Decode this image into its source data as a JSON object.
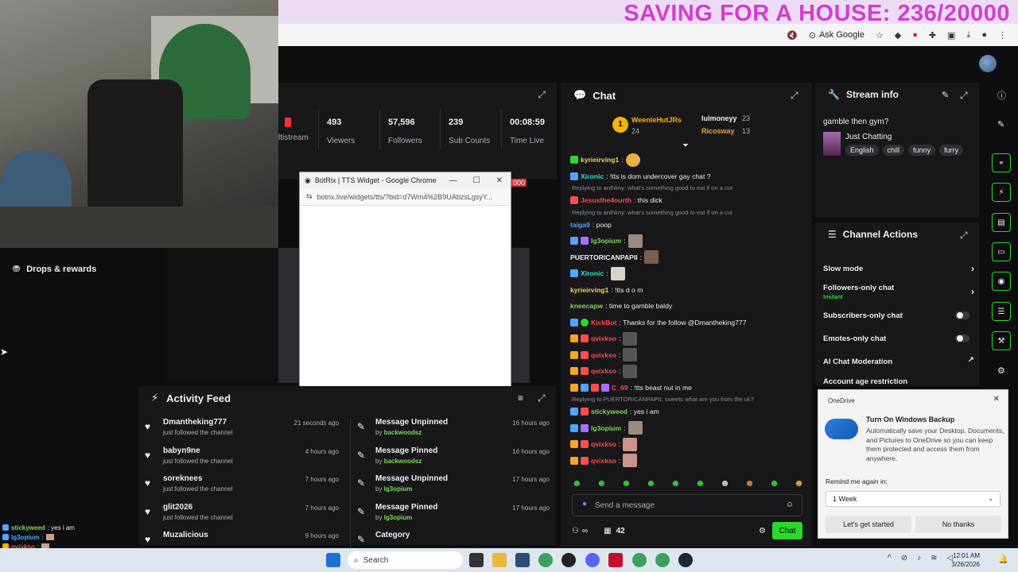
{
  "banner": {
    "text": "SAVING FOR A HOUSE: 236/20000"
  },
  "browser_toolbar": {
    "ask_google": "Ask Google"
  },
  "stats": [
    {
      "value": "",
      "label": "ltistream"
    },
    {
      "value": "493",
      "label": "Viewers"
    },
    {
      "value": "57,596",
      "label": "Followers"
    },
    {
      "value": "239",
      "label": "Sub Counts"
    },
    {
      "value": "00:08:59",
      "label": "Time Live"
    }
  ],
  "leftnav": {
    "drops": "Drops & rewards"
  },
  "tts_window": {
    "title": "BotRix | TTS Widget - Google Chrome",
    "url": "botrix.live/widgets/tts/?bid=d7Wm4%2B9UAbzsLgsyY...",
    "badge": "000"
  },
  "activity": {
    "title": "Activity Feed",
    "left": [
      {
        "name": "Dmantheking777",
        "sub": "just followed the channel",
        "time": "21 seconds ago"
      },
      {
        "name": "babyn9ne",
        "sub": "just followed the channel",
        "time": "4 hours ago"
      },
      {
        "name": "soreknees",
        "sub": "just followed the channel",
        "time": "7 hours ago"
      },
      {
        "name": "glit2026",
        "sub": "just followed the channel",
        "time": "7 hours ago"
      },
      {
        "name": "Muzalicious",
        "sub": "",
        "time": "9 hours ago"
      }
    ],
    "right": [
      {
        "name": "Message Unpinned",
        "by": "by",
        "user": "backwoodsz",
        "time": "16 hours ago"
      },
      {
        "name": "Message Pinned",
        "by": "by",
        "user": "backwoodsz",
        "time": "16 hours ago"
      },
      {
        "name": "Message Unpinned",
        "by": "by",
        "user": "lg3opium",
        "time": "17 hours ago"
      },
      {
        "name": "Message Pinned",
        "by": "by",
        "user": "lg3opium",
        "time": "17 hours ago"
      },
      {
        "name": "Category",
        "by": "",
        "user": "",
        "time": ""
      }
    ]
  },
  "left_chat": [
    {
      "user": "stickyweed",
      "text": ": yes i am"
    },
    {
      "user": "lg3opium",
      "text": ":"
    },
    {
      "user": "qvixkso",
      "text": ":"
    },
    {
      "user": "qvixkso",
      "text": ":"
    }
  ],
  "chat": {
    "title": "Chat",
    "leaders": {
      "rank": "1",
      "first": {
        "name": "WeenieHutJRs",
        "count": "24"
      },
      "second": {
        "name": "lulmoneyy",
        "count": "23"
      },
      "third": {
        "name": "Ricosway",
        "count": "13"
      }
    },
    "messages": [
      {
        "user": "kyrieirving1",
        "color": "#ffd34d",
        "text": ":"
      },
      {
        "user": "Xironic",
        "color": "#2ee6c2",
        "text": ": !tts is dom undercover gay chat ?"
      },
      {
        "reply": "Replying to anthkny: what's something good to eat if on a cut"
      },
      {
        "user": "Jesusthe4ourth",
        "color": "#ff4d4d",
        "text": ": this dick"
      },
      {
        "reply": "Replying to anthkny: what's something good to eat if on a cut"
      },
      {
        "user": "taiga9",
        "color": "#4da6ff",
        "text": ": poop"
      },
      {
        "user": "lg3opium",
        "color": "#7ed957",
        "text": ":"
      },
      {
        "user": "PUERTORICANPAPII",
        "color": "#efeff1",
        "text": ":"
      },
      {
        "user": "Xironic",
        "color": "#2ee6c2",
        "text": ":"
      },
      {
        "user": "kyrieirving1",
        "color": "#ffd34d",
        "text": ": !tts d o m"
      },
      {
        "user": "kneecapw",
        "color": "#7ed957",
        "text": ": time to gamble baldy"
      },
      {
        "user": "KickBot",
        "color": "#ff4d4d",
        "text": ": Thanks for the follow @Dmantheking777"
      },
      {
        "user": "qvixkso",
        "color": "#ff4d4d",
        "text": ":"
      },
      {
        "user": "qvixkso",
        "color": "#ff4d4d",
        "text": ":"
      },
      {
        "user": "qvixkso",
        "color": "#ff4d4d",
        "text": ":"
      },
      {
        "user": "C_69",
        "color": "#ff4d4d",
        "text": ": !tts beast nut in me"
      },
      {
        "reply": "Replying to PUERTORICANPAPII: sweets what are you from the uk?"
      },
      {
        "user": "stickyweed",
        "color": "#7ed957",
        "text": ": yes i am"
      },
      {
        "user": "lg3opium",
        "color": "#7ed957",
        "text": ":"
      },
      {
        "user": "qvixkso",
        "color": "#ff4d4d",
        "text": ":"
      },
      {
        "user": "qvixkso",
        "color": "#ff4d4d",
        "text": ":"
      }
    ],
    "input_placeholder": "Send a message",
    "infinity": "∞",
    "points": "42",
    "send": "Chat"
  },
  "stream_info": {
    "title": "Stream info",
    "stream_title": "gamble then gym?",
    "category": "Just Chatting",
    "tags": [
      "English",
      "chill",
      "funny",
      "furry"
    ]
  },
  "channel_actions": {
    "title": "Channel Actions",
    "items": [
      {
        "label": "Slow mode",
        "sub": ""
      },
      {
        "label": "Followers-only chat",
        "sub": "Instant"
      },
      {
        "label": "Subscribers-only chat",
        "sub": ""
      },
      {
        "label": "Emotes-only chat",
        "sub": ""
      },
      {
        "label": "AI Chat Moderation",
        "sub": ""
      },
      {
        "label": "Account age restriction",
        "sub": ""
      }
    ]
  },
  "onedrive_toast": {
    "app": "OneDrive",
    "title": "Turn On Windows Backup",
    "body": "Automatically save your Desktop, Documents, and Pictures to OneDrive so you can keep them protected and access them from anywhere.",
    "remind_label": "Remind me again in:",
    "remind_value": "1 Week",
    "primary": "Let's get started",
    "secondary": "No thanks"
  },
  "taskbar": {
    "search": "Search",
    "time": "12:01 AM",
    "date": "3/26/2026"
  },
  "colors": {
    "accent_green": "#2bd92b",
    "banner_pink": "#d53ccf",
    "panel_bg": "#18181b"
  }
}
